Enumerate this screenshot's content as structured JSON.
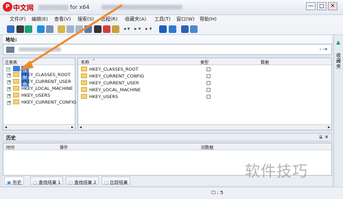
{
  "titlebar": {
    "logo_glyph": "P",
    "logo_text": "中文网",
    "title_suffix": "for x64",
    "buttons": {
      "minimize": "—",
      "maximize": "□",
      "close": "✕"
    }
  },
  "menu": [
    "文件(F)",
    "编辑(E)",
    "查看(V)",
    "搜索(S)",
    "远程(R)",
    "收藏夹(A)",
    "工具(T)",
    "窗口(W)",
    "帮助(H)"
  ],
  "address": {
    "label": "地址:"
  },
  "dock": {
    "label": "收藏夹"
  },
  "tree": {
    "header": "注册表",
    "root": "注册表",
    "items": [
      "HKEY_CLASSES_ROOT",
      "HKEY_CURRENT_USER",
      "HKEY_LOCAL_MACHINE",
      "HKEY_USERS",
      "HKEY_CURRENT_CONFIG"
    ]
  },
  "list": {
    "columns": {
      "name": "名称",
      "type": "类型",
      "data": "数据"
    },
    "rows": [
      "HKEY_CLASSES_ROOT",
      "HKEY_CURRENT_CONFIG",
      "HKEY_CURRENT_USER",
      "HKEY_LOCAL_MACHINE",
      "HKEY_USERS"
    ]
  },
  "history": {
    "title": "历史",
    "columns": {
      "time": "时间",
      "action": "操作",
      "old_data": "旧数据"
    },
    "pin": "⇊ ✕"
  },
  "tabs": [
    "历史",
    "查找结果 1",
    "查找结果 2",
    "比较结果"
  ],
  "status": {
    "count": "5"
  },
  "watermark": "软件技巧",
  "colors": {
    "accent": "#3b7ddd",
    "arrow": "#f08a2a",
    "folder": "#f4d27a"
  }
}
